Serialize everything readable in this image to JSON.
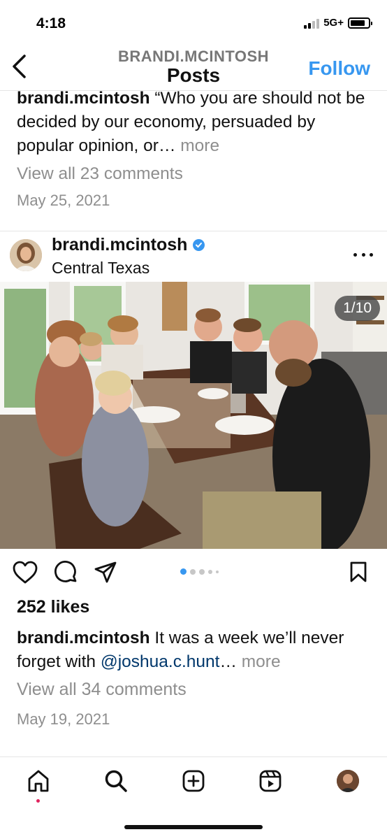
{
  "status": {
    "time": "4:18",
    "network": "5G+"
  },
  "header": {
    "username": "BRANDI.MCINTOSH",
    "title": "Posts",
    "follow": "Follow"
  },
  "prev_post": {
    "username": "brandi.mcintosh",
    "caption": "“Who you are should not be decided by our economy, persuaded by popular opinion, or…",
    "more": " more",
    "comments": "View all 23 comments",
    "date": "May 25, 2021"
  },
  "post": {
    "username": "brandi.mcintosh",
    "location": "Central Texas",
    "counter": "1/10",
    "likes": "252 likes",
    "caption_user": "brandi.mcintosh",
    "caption_text": " It was a week we’ll never forget with ",
    "mention": "@joshua.c.hunt",
    "ellipsis": "…",
    "more": " more",
    "comments": "View all 34 comments",
    "date": "May 19, 2021"
  },
  "icons": {
    "back": "chevron-left-icon",
    "verified": "verified-badge-icon",
    "more": "more-horizontal-icon",
    "like": "heart-icon",
    "comment": "comment-icon",
    "share": "paper-plane-icon",
    "save": "bookmark-icon",
    "tabs": [
      "home-icon",
      "search-icon",
      "create-icon",
      "reels-icon",
      "profile-avatar"
    ]
  },
  "colors": {
    "accent": "#3797f0",
    "muted": "#8e8e8e",
    "mention": "#00376b",
    "notification": "#e0245e"
  }
}
